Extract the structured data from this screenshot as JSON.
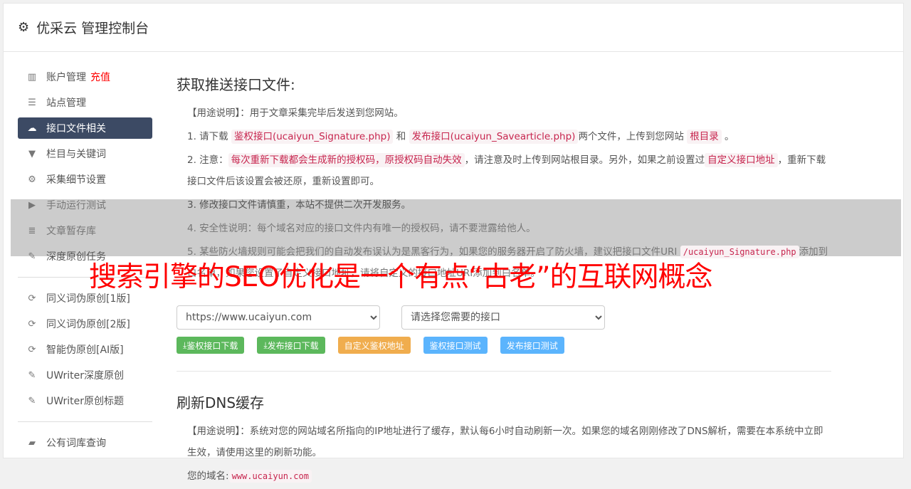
{
  "header": {
    "title": "优采云 管理控制台",
    "icon": "gear-icon"
  },
  "sidebar": {
    "items": [
      {
        "label": "账户管理",
        "badge": "充值",
        "icon": "bar-chart-icon"
      },
      {
        "label": "站点管理",
        "icon": "server-icon"
      },
      {
        "label": "接口文件相关",
        "icon": "cloud-upload-icon",
        "active": true
      },
      {
        "label": "栏目与关键词",
        "icon": "filter-icon"
      },
      {
        "label": "采集细节设置",
        "icon": "cogs-icon"
      },
      {
        "label": "手动运行测试",
        "icon": "play-icon"
      },
      {
        "label": "文章暂存库",
        "icon": "database-icon"
      },
      {
        "label": "深度原创任务",
        "icon": "edit-icon"
      }
    ],
    "items2": [
      {
        "label": "同义词伪原创[1版]",
        "icon": "refresh-icon"
      },
      {
        "label": "同义词伪原创[2版]",
        "icon": "refresh-icon"
      },
      {
        "label": "智能伪原创[AI版]",
        "icon": "refresh-icon"
      },
      {
        "label": "UWriter深度原创",
        "icon": "edit-icon"
      },
      {
        "label": "UWriter原创标题",
        "icon": "edit-icon"
      }
    ],
    "items3": [
      {
        "label": "公有词库查询",
        "icon": "book-icon"
      }
    ]
  },
  "main": {
    "title": "获取推送接口文件:",
    "usage": "【用途说明】：用于文章采集完毕后发送到您网站。",
    "p1": {
      "a": "1. 请下载",
      "c1": "鉴权接口(ucaiyun_Signature.php)",
      "b": "和",
      "c2": "发布接口(ucaiyun_Savearticle.php)",
      "d": "两个文件，上传到您网站",
      "c3": "根目录",
      "e": "。"
    },
    "p2": {
      "a": "2. 注意：",
      "c1": "每次重新下载都会生成新的授权码，原授权码自动失效",
      "b": "，请注意及时上传到网站根目录。另外，如果之前设置过",
      "c2": "自定义接口地址",
      "d": "，重新下载接口文件后该设置会被还原，重新设置即可。"
    },
    "p3": "3. 修改接口文件请慎重，本站不提供二次开发服务。",
    "p4": "4. 安全性说明：每个域名对应的接口文件内有唯一的授权码，请不要泄露给他人。",
    "p5": {
      "a": "5. 某些防火墙规则可能会把我们的自动发布误认为是黑客行为，如果您的服务器开启了防火墙，建议把接口文件URI",
      "c1": "/ucaiyun_Signature.php",
      "b": "添加到白名单，如果您设置了自定义接口地址，请将自定义的接口地址URI添加到白名单。"
    },
    "site_select": "https://www.ucaiyun.com",
    "api_select": "请选择您需要的接口",
    "buttons": {
      "auth_download": "鉴权接口下载",
      "publish_download": "发布接口下载",
      "custom_auth": "自定义鉴权地址",
      "auth_test": "鉴权接口测试",
      "publish_test": "发布接口测试"
    },
    "dns_title": "刷新DNS缓存",
    "dns_usage": "【用途说明】：系统对您的网站域名所指向的IP地址进行了缓存，默认每6小时自动刷新一次。如果您的域名刚刚修改了DNS解析，需要在本系统中立即生效，请使用这里的刷新功能。",
    "domain_label": "您的域名:",
    "domain_value": "www.ucaiyun.com"
  },
  "banner": "搜索引擎的SEO优化是一个有点“古老”的互联网概念",
  "colors": {
    "active": "#3c4a64",
    "green": "#5cb85c",
    "orange": "#f0ad4e",
    "blue": "#5bb4fd",
    "banner": "#ff0000"
  }
}
